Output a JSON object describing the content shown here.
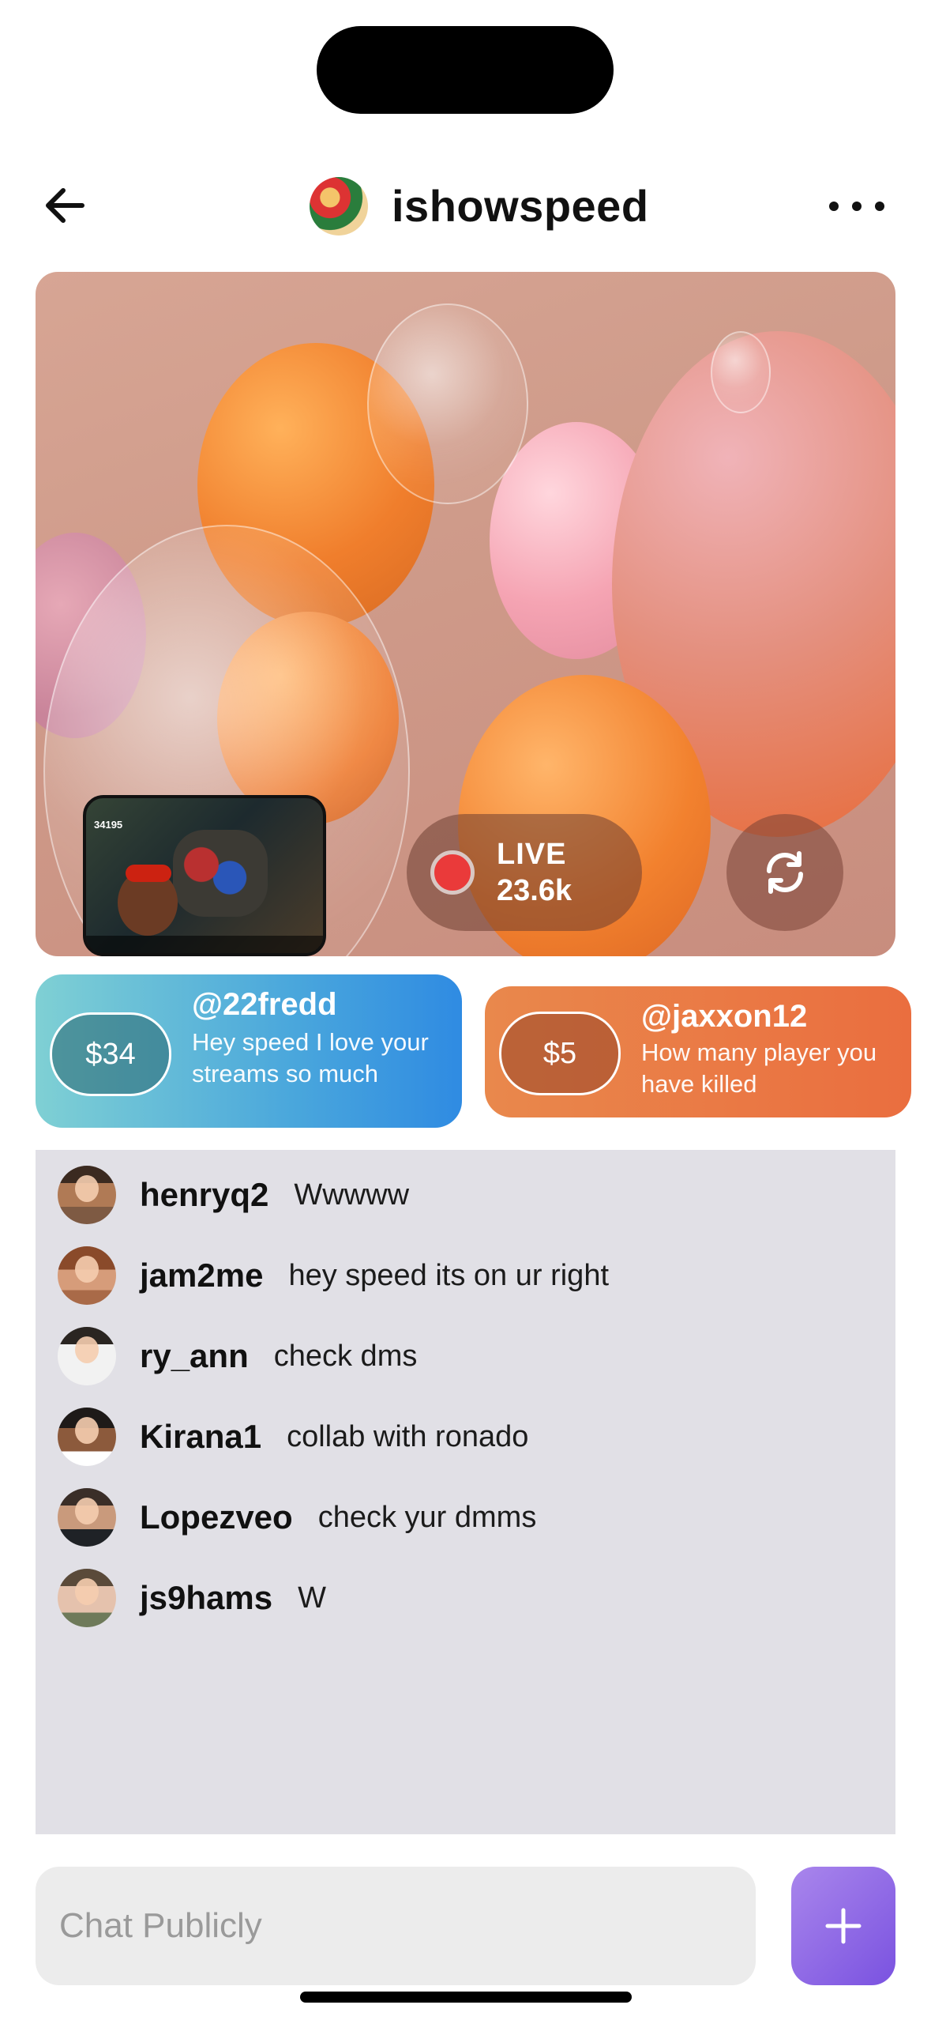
{
  "header": {
    "title": "ishowspeed",
    "back_icon": "arrow-left-icon",
    "more_icon": "ellipsis-icon"
  },
  "stream": {
    "live_label": "LIVE",
    "viewer_count": "23.6k",
    "pip_counter": "34195",
    "refresh_icon": "refresh-icon"
  },
  "donations": [
    {
      "amount": "$34",
      "handle": "@22fredd",
      "message": "Hey speed I love your streams so much"
    },
    {
      "amount": "$5",
      "handle": "@jaxxon12",
      "message": "How many player you have killed"
    }
  ],
  "chat": [
    {
      "user": "henryq2",
      "text": "Wwwww"
    },
    {
      "user": "jam2me",
      "text": "hey speed its on ur right"
    },
    {
      "user": "ry_ann",
      "text": "check dms"
    },
    {
      "user": "Kirana1",
      "text": "collab with ronado"
    },
    {
      "user": "Lopezveo",
      "text": "check yur dmms"
    },
    {
      "user": "js9hams",
      "text": "W"
    }
  ],
  "composer": {
    "placeholder": "Chat Publicly",
    "add_icon": "plus-icon"
  },
  "colors": {
    "live_red": "#ea3a3a",
    "donation_blue": "#2f8be2",
    "donation_orange": "#ea6e3f",
    "accent_purple": "#7a52e0",
    "chat_bg": "#e1e0e6"
  }
}
